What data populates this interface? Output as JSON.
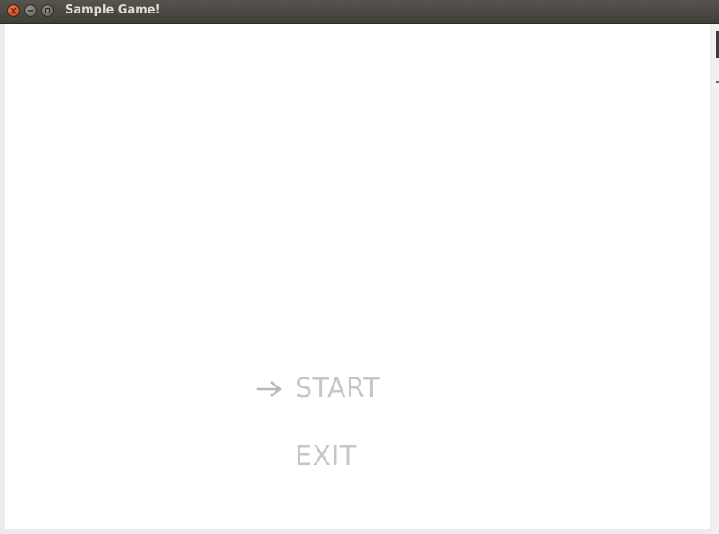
{
  "window": {
    "title": "Sample Game!"
  },
  "menu": {
    "items": [
      {
        "label": "START",
        "selected": true
      },
      {
        "label": "EXIT",
        "selected": false
      }
    ],
    "selector_icon": "arrow-right-icon",
    "text_color": "#c6c6c6"
  },
  "colors": {
    "titlebar": "#4a4843",
    "close_button": "#e4521f",
    "content_background": "#ffffff"
  }
}
